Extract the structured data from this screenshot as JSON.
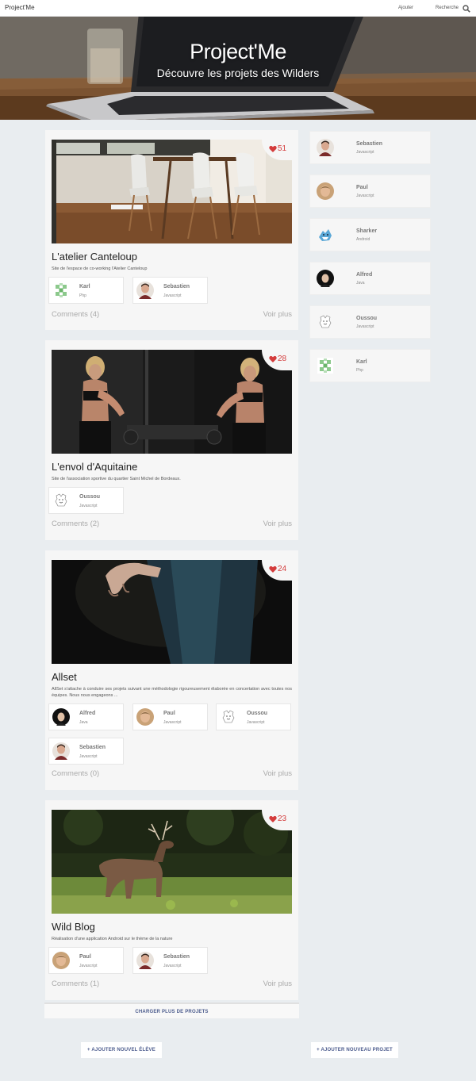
{
  "nav": {
    "brand": "Project'Me",
    "add": "Ajouter",
    "search": "Recherche"
  },
  "hero": {
    "title": "Project'Me",
    "subtitle": "Découvre les projets des Wilders"
  },
  "projects": [
    {
      "likes": "51",
      "title": "L'atelier Canteloup",
      "description": "Site de l'espace de co-working l'Atelier Canteloup",
      "members": [
        {
          "name": "Karl",
          "lang": "Php"
        },
        {
          "name": "Sebastien",
          "lang": "Javascript"
        }
      ],
      "comments": "Comments (4)",
      "more": "Voir plus"
    },
    {
      "likes": "28",
      "title": "L'envol d'Aquitaine",
      "description": "Site de l'association sportive du quartier Saint Michel de Bordeaux.",
      "members": [
        {
          "name": "Oussou",
          "lang": "Javascript"
        }
      ],
      "comments": "Comments (2)",
      "more": "Voir plus"
    },
    {
      "likes": "24",
      "title": "Allset",
      "description": "AllSet s'attache à conduire ses projets suivant une méthodologie rigoureusement élaborée en concertation avec toutes nos équipes. Nous nous engageons ...",
      "members": [
        {
          "name": "Alfred",
          "lang": "Java"
        },
        {
          "name": "Paul",
          "lang": "Javascript"
        },
        {
          "name": "Oussou",
          "lang": "Javascript"
        },
        {
          "name": "Sebastien",
          "lang": "Javascript"
        }
      ],
      "comments": "Comments (0)",
      "more": "Voir plus"
    },
    {
      "likes": "23",
      "title": "Wild Blog",
      "description": "Réalisation d'une application Android sur le thème de la nature",
      "members": [
        {
          "name": "Paul",
          "lang": "Javascript"
        },
        {
          "name": "Sebastien",
          "lang": "Javascript"
        }
      ],
      "comments": "Comments (1)",
      "more": "Voir plus"
    }
  ],
  "students": [
    {
      "name": "Sebastien",
      "lang": "Javascript"
    },
    {
      "name": "Paul",
      "lang": "Javascript"
    },
    {
      "name": "Sharker",
      "lang": "Android"
    },
    {
      "name": "Alfred",
      "lang": "Java"
    },
    {
      "name": "Oussou",
      "lang": "Javascript"
    },
    {
      "name": "Karl",
      "lang": "Php"
    }
  ],
  "actions": {
    "load_more": "CHARGER PLUS DE PROJETS",
    "add_student": "+ AJOUTER NOUVEL ÉLÈVE",
    "add_project": "+ AJOUTER NOUVEAU PROJET"
  },
  "colors": {
    "heart": "#d43c3c",
    "action_text": "#4a5a8c",
    "page_bg": "#e9edf0"
  }
}
